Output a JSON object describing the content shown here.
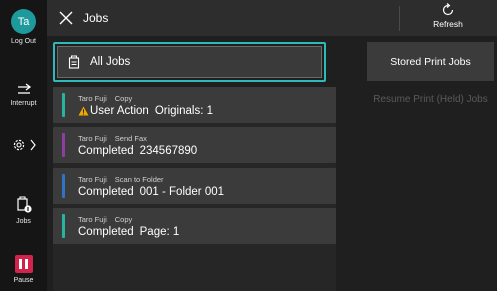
{
  "rail": {
    "avatar_initials": "Ta",
    "logout_label": "Log Out",
    "interrupt_label": "Interrupt",
    "jobs_label": "Jobs",
    "pause_label": "Pause"
  },
  "header": {
    "title": "Jobs",
    "refresh_label": "Refresh"
  },
  "all_jobs": {
    "label": "All Jobs"
  },
  "jobs": [
    {
      "user": "Taro Fuji",
      "type": "Copy",
      "state": "User Action",
      "detail": "Originals: 1",
      "color": "#27b3a2",
      "warning": true
    },
    {
      "user": "Taro Fuji",
      "type": "Send Fax",
      "state": "Completed",
      "detail": "234567890",
      "color": "#8c3fa0",
      "warning": false
    },
    {
      "user": "Taro Fuji",
      "type": "Scan to Folder",
      "state": "Completed",
      "detail": "001 - Folder 001",
      "color": "#2f73c5",
      "warning": false
    },
    {
      "user": "Taro Fuji",
      "type": "Copy",
      "state": "Completed",
      "detail": "Page: 1",
      "color": "#27b3a2",
      "warning": false
    }
  ],
  "right": {
    "stored_label": "Stored Print Jobs",
    "resume_label": "Resume Print (Held) Jobs"
  },
  "colors": {
    "accent": "#2fbab9",
    "pause": "#d1244d",
    "warning": "#f2a900"
  }
}
